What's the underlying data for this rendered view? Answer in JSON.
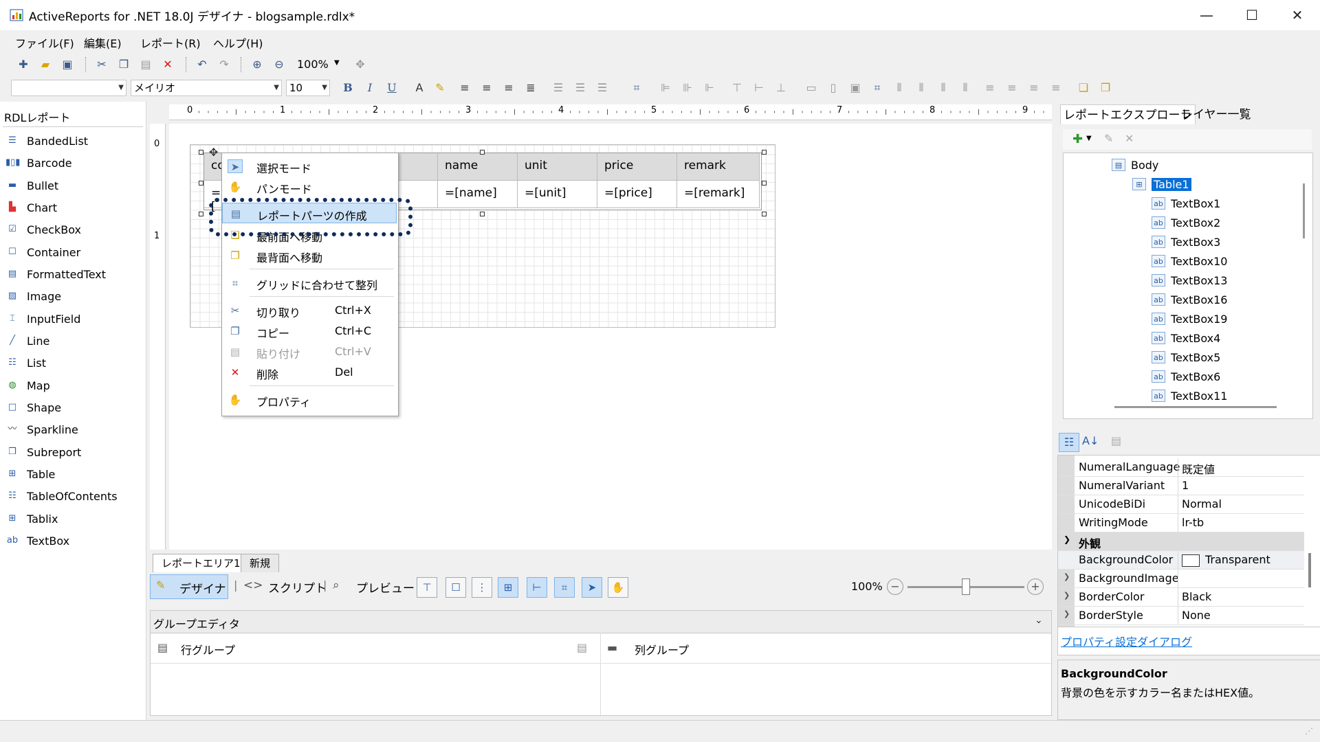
{
  "window": {
    "title": "ActiveReports for .NET 18.0J デザイナ - blogsample.rdlx*",
    "minimize": "—",
    "maximize": "☐",
    "close": "✕"
  },
  "menu": [
    "ファイル(F)",
    "編集(E)",
    "レポート(R)",
    "ヘルプ(H)"
  ],
  "toolbar1": {
    "zoom": "100%"
  },
  "toolbar2": {
    "font": "メイリオ",
    "size": "10"
  },
  "toolbox": {
    "header": "RDLレポート",
    "items": [
      "BandedList",
      "Barcode",
      "Bullet",
      "Chart",
      "CheckBox",
      "Container",
      "FormattedText",
      "Image",
      "InputField",
      "Line",
      "List",
      "Map",
      "Shape",
      "Sparkline",
      "Subreport",
      "Table",
      "TableOfContents",
      "Tablix",
      "TextBox"
    ]
  },
  "ruler": {
    "h": [
      "0",
      "1",
      "2",
      "3",
      "4",
      "5",
      "6",
      "7",
      "8",
      "9"
    ],
    "v": [
      "0",
      "1"
    ]
  },
  "table": {
    "header": [
      "co",
      "",
      "name",
      "unit",
      "price",
      "remark"
    ],
    "detail": [
      "=[",
      "",
      "=[name]",
      "=[unit]",
      "=[price]",
      "=[remark]"
    ]
  },
  "context_menu": {
    "items": [
      {
        "label": "選択モード",
        "shortcut": "",
        "icon": "pointer-icon",
        "state": "normal"
      },
      {
        "label": "パンモード",
        "shortcut": "",
        "icon": "hand-icon",
        "state": "normal"
      },
      {
        "label": "レポートパーツの作成",
        "shortcut": "",
        "icon": "report-part-icon",
        "state": "highlighted"
      },
      {
        "label": "最前面へ移動",
        "shortcut": "",
        "icon": "bring-front-icon",
        "state": "normal"
      },
      {
        "label": "最背面へ移動",
        "shortcut": "",
        "icon": "send-back-icon",
        "state": "normal"
      },
      {
        "label": "グリッドに合わせて整列",
        "shortcut": "",
        "icon": "grid-align-icon",
        "state": "normal"
      },
      {
        "label": "切り取り",
        "shortcut": "Ctrl+X",
        "icon": "cut-icon",
        "state": "normal"
      },
      {
        "label": "コピー",
        "shortcut": "Ctrl+C",
        "icon": "copy-icon",
        "state": "normal"
      },
      {
        "label": "貼り付け",
        "shortcut": "Ctrl+V",
        "icon": "paste-icon",
        "state": "disabled"
      },
      {
        "label": "削除",
        "shortcut": "Del",
        "icon": "delete-icon",
        "state": "normal"
      },
      {
        "label": "プロパティ",
        "shortcut": "",
        "icon": "properties-icon",
        "state": "normal"
      }
    ]
  },
  "tabs": [
    "レポートエリア1",
    "新規"
  ],
  "view_buttons": {
    "design": "デザイナ",
    "script": "スクリプト",
    "preview": "プレビュー"
  },
  "zoom": {
    "value": "100%",
    "level": 0.5
  },
  "group_editor": {
    "title": "グループエディタ",
    "row_group": "行グループ",
    "col_group": "列グループ"
  },
  "explorer": {
    "tabs": [
      "レポートエクスプローラ",
      "レイヤー一覧"
    ],
    "tree": [
      "Body",
      "Table1",
      "TextBox1",
      "TextBox2",
      "TextBox3",
      "TextBox10",
      "TextBox13",
      "TextBox16",
      "TextBox19",
      "TextBox4",
      "TextBox5",
      "TextBox6",
      "TextBox11"
    ]
  },
  "properties": {
    "rows": [
      {
        "name": "NumeralLanguage",
        "value": "既定値"
      },
      {
        "name": "NumeralVariant",
        "value": "1"
      },
      {
        "name": "UnicodeBiDi",
        "value": "Normal"
      },
      {
        "name": "WritingMode",
        "value": "lr-tb"
      }
    ],
    "category": "外観",
    "rows2": [
      {
        "name": "BackgroundColor",
        "value": "Transparent"
      },
      {
        "name": "BackgroundImage",
        "value": ""
      },
      {
        "name": "BorderColor",
        "value": "Black"
      },
      {
        "name": "BorderStyle",
        "value": "None"
      }
    ],
    "dialog_link": "プロパティ設定ダイアログ",
    "desc_title": "BackgroundColor",
    "desc_text": "背景の色を示すカラー名またはHEX値。"
  },
  "colors": {
    "accent": "#0a6fd6",
    "highlight": "#cde3f7",
    "selection": "#0a6fd6"
  }
}
